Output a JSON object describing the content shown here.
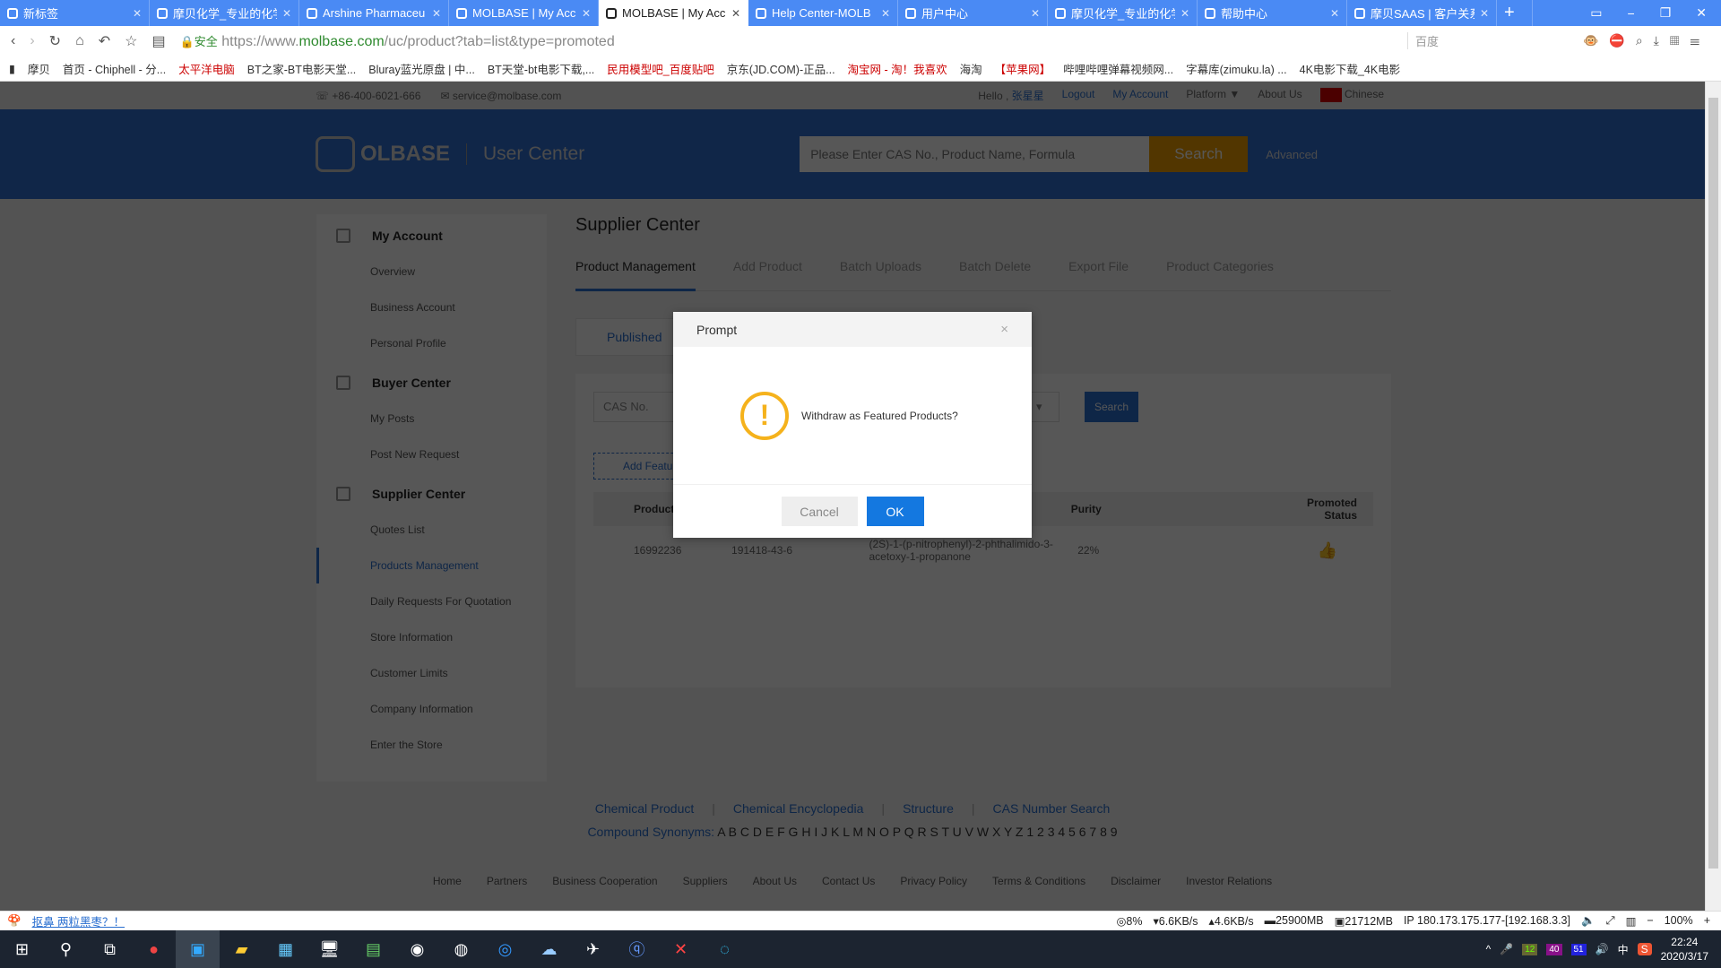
{
  "browser": {
    "tabs": [
      {
        "label": "新标签",
        "active": false
      },
      {
        "label": "摩贝化学_专业的化学",
        "active": false
      },
      {
        "label": "Arshine Pharmaceu",
        "active": false
      },
      {
        "label": "MOLBASE | My Acc",
        "active": false
      },
      {
        "label": "MOLBASE | My Acc",
        "active": true
      },
      {
        "label": "Help Center-MOLB",
        "active": false
      },
      {
        "label": "用户中心",
        "active": false
      },
      {
        "label": "摩贝化学_专业的化学",
        "active": false
      },
      {
        "label": "帮助中心",
        "active": false
      },
      {
        "label": "摩贝SAAS | 客户关系",
        "active": false
      }
    ],
    "new_tab": "+",
    "secure_label": "安全",
    "url_prefix": "https://www.",
    "url_domain": "molbase.com",
    "url_path": "/uc/product?tab=list&type=promoted",
    "search_engine": "百度",
    "bookmarks": [
      "摩贝",
      "首页 - Chiphell - 分...",
      "太平洋电脑",
      "BT之家-BT电影天堂...",
      "Bluray蓝光原盘 | 中...",
      "BT天堂-bt电影下载,...",
      "民用模型吧_百度贴吧",
      "京东(JD.COM)-正品...",
      "淘宝网 - 淘！我喜欢",
      "海淘",
      "【苹果网】",
      "哔哩哔哩弹幕视频网...",
      "字幕库(zimuku.la) ...",
      "4K电影下载_4K电影"
    ]
  },
  "topbar": {
    "phone": "+86-400-6021-666",
    "email": "service@molbase.com",
    "hello": "Hello ,",
    "username": "张星星",
    "logout": "Logout",
    "my_account": "My Account",
    "platform": "Platform ▼",
    "about": "About Us",
    "language": "Chinese"
  },
  "header": {
    "logo": "OLBASE",
    "section": "User Center",
    "search_placeholder": "Please Enter CAS No., Product Name, Formula",
    "search_button": "Search",
    "advanced": "Advanced",
    "brand_color": "#2f6fd4",
    "search_color": "#f0a000"
  },
  "sidebar": {
    "groups": [
      {
        "title": "My Account",
        "icon": "account-icon",
        "items": [
          "Overview",
          "Business Account",
          "Personal Profile"
        ]
      },
      {
        "title": "Buyer Center",
        "icon": "cart-icon",
        "items": [
          "My Posts",
          "Post New Request"
        ]
      },
      {
        "title": "Supplier Center",
        "icon": "store-icon",
        "items": [
          "Quotes List",
          "Products Management",
          "Daily Requests For Quotation",
          "Store Information",
          "Customer Limits",
          "Company Information",
          "Enter the Store"
        ]
      }
    ],
    "active": "Products Management"
  },
  "main": {
    "title": "Supplier Center",
    "tabs": [
      "Product Management",
      "Add Product",
      "Batch Uploads",
      "Batch Delete",
      "Export File",
      "Product Categories"
    ],
    "subtab": "Published",
    "filter_placeholder": "CAS No.",
    "search_button": "Search",
    "add_featured": "Add Featu",
    "columns": [
      "Product",
      "",
      "",
      "Purity",
      "Promoted Status"
    ],
    "rows": [
      {
        "product": "16992236",
        "cas": "191418-43-6",
        "name": "(2S)-1-(p-nitrophenyl)-2-phthalimido-3-acetoxy-1-propanone",
        "purity": "22%",
        "status_icon": "thumbs-up-icon"
      }
    ]
  },
  "footer": {
    "links": [
      "Chemical Product",
      "Chemical Encyclopedia",
      "Structure",
      "CAS Number Search"
    ],
    "synonyms_label": "Compound Synonyms:",
    "synonyms": "A B C D E F G H I J K L M N O P Q R S T U V W X Y Z 1 2 3 4 5 6 7 8 9",
    "bottom": [
      "Home",
      "Partners",
      "Business Cooperation",
      "Suppliers",
      "About Us",
      "Contact Us",
      "Privacy Policy",
      "Terms & Conditions",
      "Disclaimer",
      "Investor Relations"
    ]
  },
  "modal": {
    "title": "Prompt",
    "close": "×",
    "message": "Withdraw as Featured Products?",
    "cancel": "Cancel",
    "ok": "OK",
    "warn_color": "#f5b21c",
    "ok_color": "#1478e0"
  },
  "statusbar": {
    "news": "抠鼻 两粒黑枣？！",
    "cpu": "8%",
    "down": "6.6KB/s",
    "up": "4.6KB/s",
    "mem1": "25900MB",
    "mem2": "21712MB",
    "ip": "IP 180.173.175.177-[192.168.3.3]",
    "zoom": "100%",
    "minus": "−",
    "plus": "+"
  },
  "taskbar": {
    "time": "22:24",
    "date": "2020/3/17",
    "ime": "中",
    "badges": [
      "12",
      "40",
      "51"
    ]
  }
}
